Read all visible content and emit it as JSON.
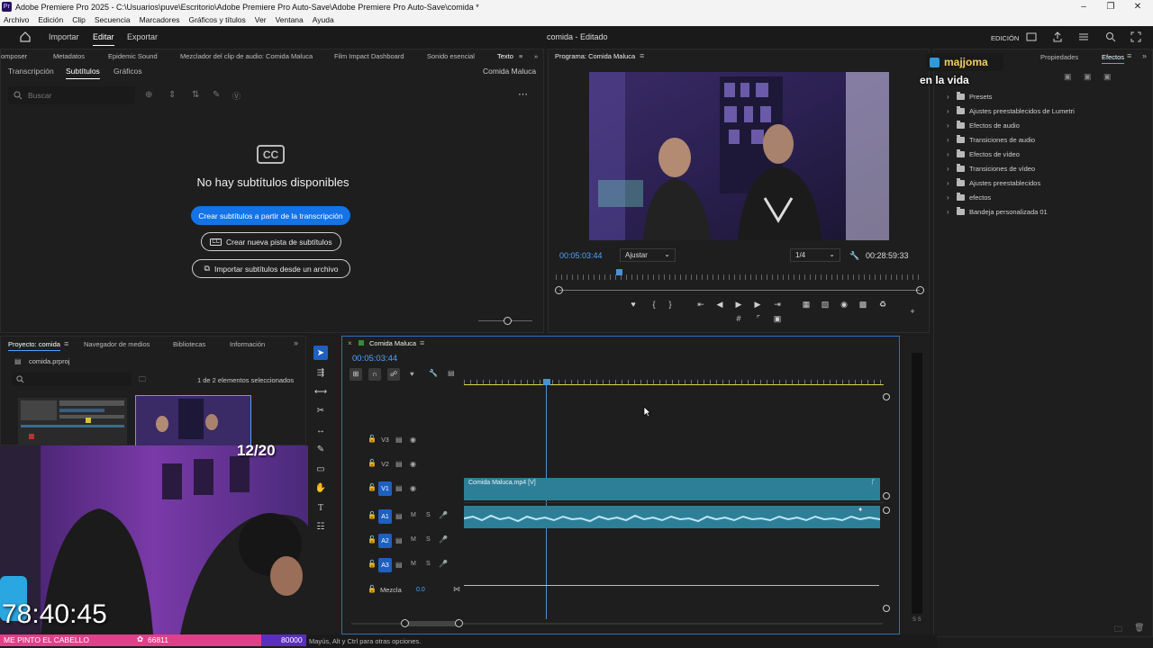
{
  "window": {
    "title": "Adobe Premiere Pro 2025 - C:\\Usuarios\\puve\\Escritorio\\Adobe Premiere Pro Auto-Save\\Adobe Premiere Pro Auto-Save\\comida *",
    "logo": "Pr"
  },
  "menu": [
    "Archivo",
    "Edición",
    "Clip",
    "Secuencia",
    "Marcadores",
    "Gráficos y títulos",
    "Ver",
    "Ventana",
    "Ayuda"
  ],
  "header": {
    "tabs": [
      "Importar",
      "Editar",
      "Exportar"
    ],
    "active_tab": "Editar",
    "project_title": "comida - Editado",
    "workspace": "EDICIÓN"
  },
  "top_left_panel": {
    "tabs": [
      "omposer",
      "Metadatos",
      "Epidemic Sound",
      "Mezclador del clip de audio: Comida Maluca",
      "Film Impact Dashboard",
      "Sonido esencial",
      "Texto"
    ],
    "subtabs": [
      "Transcripción",
      "Subtítulos",
      "Gráficos"
    ],
    "sequence_name": "Comida Maluca",
    "search_placeholder": "Buscar",
    "cc_badge": "CC",
    "empty_message": "No hay subtítulos disponibles",
    "btn_create_from_transcript": "Crear subtítulos a partir de la transcripción",
    "btn_new_track": "Crear nueva pista de subtítulos",
    "btn_import": "Importar subtítulos desde un archivo"
  },
  "program_monitor": {
    "title": "Programa: Comida Maluca",
    "timecode": "00:05:03:44",
    "fit": "Ajustar",
    "resolution": "1/4",
    "duration": "00:28:59:33"
  },
  "right_panel": {
    "tabs": [
      "icos",
      "Propiedades",
      "Efectos"
    ],
    "items": [
      "Presets",
      "Ajustes preestablecidos de Lumetri",
      "Efectos de audio",
      "Transiciones de audio",
      "Efectos de vídeo",
      "Transiciones de vídeo",
      "Ajustes preestablecidos",
      "efectos",
      "Bandeja personalizada 01"
    ]
  },
  "stream_overlay": {
    "username": "majjoma",
    "caption": "en la vida",
    "counter": "12/20",
    "timer": "78:40:45",
    "ticker_text": "ME PINTO EL CABELLO",
    "ticker_value_1": "66811",
    "ticker_value_2": "80000"
  },
  "project_panel": {
    "tabs": [
      "Proyecto: comida",
      "Navegador de medios",
      "Bibliotecas",
      "Información"
    ],
    "file": "comida.prproj",
    "selection_info": "1 de 2 elementos seleccionados"
  },
  "timeline": {
    "sequence_tab": "Comida Maluca",
    "timecode": "00:05:03:44",
    "tracks": [
      {
        "id": "V3",
        "type": "video",
        "targeted": false
      },
      {
        "id": "V2",
        "type": "video",
        "targeted": false
      },
      {
        "id": "V1",
        "type": "video",
        "targeted": true
      },
      {
        "id": "A1",
        "type": "audio",
        "targeted": true
      },
      {
        "id": "A2",
        "type": "audio",
        "targeted": true
      },
      {
        "id": "A3",
        "type": "audio",
        "targeted": true
      }
    ],
    "mix_label": "Mezcla",
    "mix_value": "0.0",
    "clip_name": "Comida Maluca.mp4 [V]",
    "audio_m": "M",
    "audio_s": "S",
    "meter_label": "S S"
  },
  "status_bar": {
    "hint": "Mayús, Alt y Ctrl para otras opciones."
  },
  "colors": {
    "accent": "#1473e6",
    "clip": "#2d7f98",
    "playhead": "#4a90d9",
    "ticker_pink": "#e0408a",
    "ticker_purple": "#5a2fc0"
  }
}
